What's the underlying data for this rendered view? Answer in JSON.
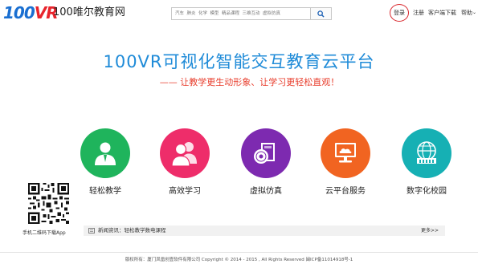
{
  "header": {
    "logo_text_a": "100",
    "logo_text_b": "VR",
    "site_name": "100唯尔教育网",
    "search": {
      "placeholder": "汽车  肺炎  化学  模型  精品课程  三维互动  虚拟仿真",
      "button_icon": "search-icon"
    },
    "nav": {
      "login": "登录",
      "register": "注册",
      "client_download": "客户端下载",
      "help": "帮助",
      "help_caret": "⌄"
    },
    "accent_color": "#1f8bd8",
    "highlight_ring_color": "#d8262c"
  },
  "hero": {
    "title": "100VR可视化智能交互教育云平台",
    "subtitle": "—— 让教学更生动形象、让学习更轻松直观！"
  },
  "features": [
    {
      "label": "轻松教学",
      "icon": "teacher-icon",
      "color": "#1fb45c"
    },
    {
      "label": "高效学习",
      "icon": "students-icon",
      "color": "#ee2d6a"
    },
    {
      "label": "虚拟仿真",
      "icon": "disc-book-icon",
      "color": "#7d2ab0"
    },
    {
      "label": "云平台服务",
      "icon": "cloud-service-icon",
      "color": "#f16421"
    },
    {
      "label": "数字化校园",
      "icon": "campus-icon",
      "color": "#16b0b4"
    }
  ],
  "qr": {
    "caption": "手机二维码下载App"
  },
  "news": {
    "text": "新闻资讯：轻松教学数电课程",
    "more": "更多>>"
  },
  "footer": {
    "text": "版权所有：厦门凤凰创壹软件有限公司  Copyright © 2014 - 2015  , All Rights Reserved  闽ICP备11014918号-1"
  }
}
